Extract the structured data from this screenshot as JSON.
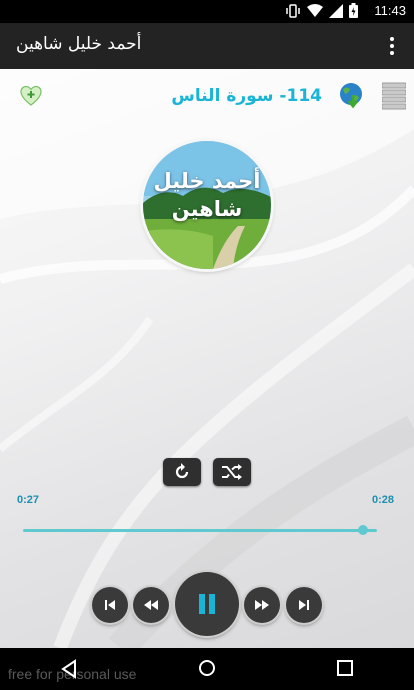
{
  "status_bar": {
    "time": "11:43"
  },
  "app_bar": {
    "title": "أحمد خليل شاهين"
  },
  "player": {
    "surah_title": "114- سورة الناس",
    "artwork_text_line1": "أحمد خليل",
    "artwork_text_line2": "شاهين",
    "elapsed": "0:27",
    "duration": "0:28",
    "progress": 0.96
  },
  "watermark": "free for personal use",
  "colors": {
    "accent": "#1ab4d6",
    "seek": "#5fc9cf",
    "appbar": "#232323",
    "button": "#3a3a3a"
  },
  "icons": [
    "vibrate-icon",
    "wifi-icon",
    "signal-icon",
    "battery-icon",
    "overflow-menu-icon",
    "favorite-add-icon",
    "globe-download-icon",
    "playlist-icon",
    "repeat-icon",
    "shuffle-icon",
    "skip-previous-icon",
    "rewind-icon",
    "pause-icon",
    "fast-forward-icon",
    "skip-next-icon",
    "back-icon",
    "home-icon",
    "recents-icon"
  ]
}
